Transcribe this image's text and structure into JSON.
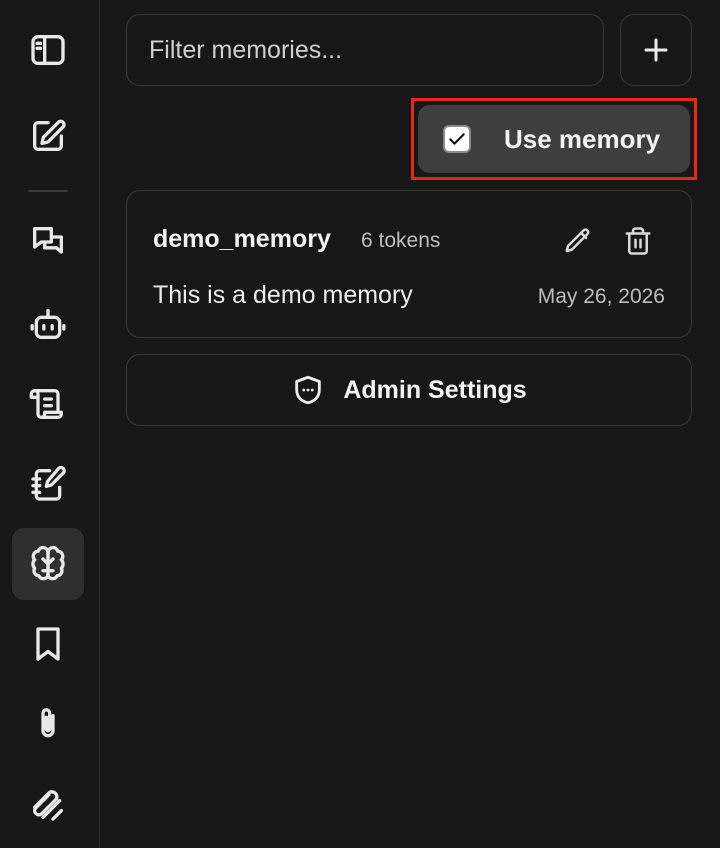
{
  "sidebar": {
    "items": [
      {
        "icon": "sidebar-panel-icon"
      },
      {
        "icon": "new-chat-icon"
      },
      {
        "icon": "chats-icon"
      },
      {
        "icon": "bot-icon"
      },
      {
        "icon": "scroll-icon"
      },
      {
        "icon": "notebook-icon"
      },
      {
        "icon": "brain-icon",
        "active": true
      },
      {
        "icon": "bookmark-icon"
      },
      {
        "icon": "paperclip-icon"
      },
      {
        "icon": "prompts-icon"
      }
    ]
  },
  "memories": {
    "filter_placeholder": "Filter memories...",
    "add_icon": "plus-icon",
    "use_memory_label": "Use memory",
    "use_memory_checked": true,
    "items": [
      {
        "name": "demo_memory",
        "tokens": "6 tokens",
        "content": "This is a demo memory",
        "date": "May 26, 2026"
      }
    ],
    "admin_settings_label": "Admin Settings"
  },
  "colors": {
    "background": "#171717",
    "border": "#3a3a3a",
    "active_rail": "#2f2f2f",
    "toggle_bg": "#3e3e3e",
    "highlight": "#e8280f"
  }
}
